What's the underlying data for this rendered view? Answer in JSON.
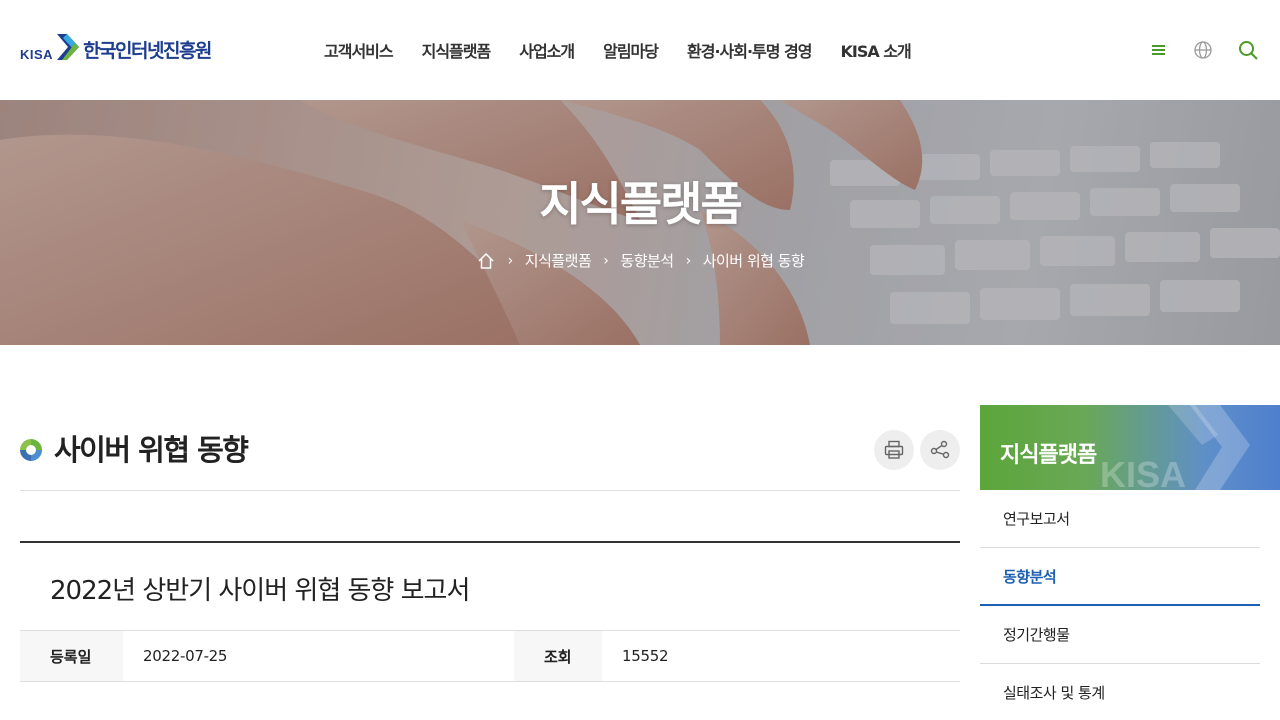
{
  "header": {
    "logo_abbr": "KISA",
    "logo_name": "한국인터넷진흥원",
    "nav": [
      "고객서비스",
      "지식플랫폼",
      "사업소개",
      "알림마당",
      "환경·사회·투명 경영",
      "KISA 소개"
    ],
    "icons": [
      "menu-icon",
      "globe-icon",
      "search-icon"
    ]
  },
  "hero": {
    "title": "지식플랫폼",
    "breadcrumb": [
      "지식플랫폼",
      "동향분석",
      "사이버 위협 동향"
    ]
  },
  "page": {
    "title": "사이버 위협 동향"
  },
  "article": {
    "title": "2022년 상반기 사이버 위협 동향 보고서",
    "date_label": "등록일",
    "date_value": "2022-07-25",
    "views_label": "조회",
    "views_value": "15552"
  },
  "side": {
    "title": "지식플랫폼",
    "watermark": "KISA",
    "items": [
      {
        "label": "연구보고서",
        "active": false
      },
      {
        "label": "동향분석",
        "active": true
      },
      {
        "label": "정기간행물",
        "active": false
      },
      {
        "label": "실태조사 및 통계",
        "active": false
      }
    ]
  },
  "colors": {
    "brand_blue": "#1d3d8f",
    "brand_green": "#5ca53a",
    "active_link": "#1e5fb3"
  }
}
